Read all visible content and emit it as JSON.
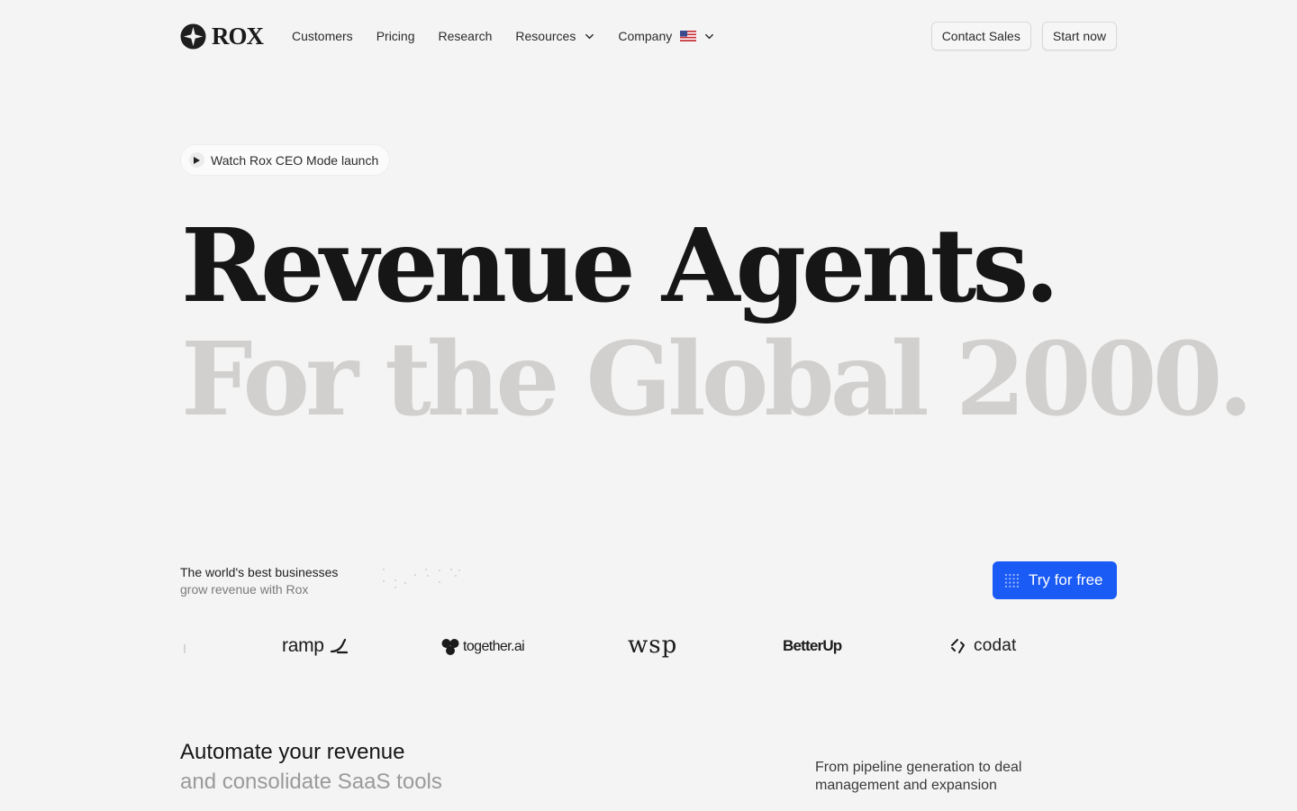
{
  "brand": {
    "name": "ROX",
    "icon": "compass-star-icon"
  },
  "nav": {
    "links": [
      {
        "label": "Customers"
      },
      {
        "label": "Pricing"
      },
      {
        "label": "Research"
      },
      {
        "label": "Resources"
      },
      {
        "label": "Company"
      }
    ],
    "contact_label": "Contact Sales",
    "start_label": "Start now"
  },
  "announcement": {
    "label": "Watch Rox CEO Mode launch"
  },
  "hero": {
    "line1": "Revenue Agents.",
    "line2": "For the Global 2000."
  },
  "proof": {
    "line1": "The world's best businesses",
    "line2": "grow revenue with Rox"
  },
  "cta": {
    "label": "Try for free"
  },
  "logos": [
    "ramp",
    "together.ai",
    "wsp",
    "BetterUp",
    "codat"
  ],
  "bottom": {
    "left_line1": "Automate your revenue",
    "left_line2": "and consolidate SaaS tools",
    "right_text": "From pipeline generation to deal management and expansion"
  },
  "colors": {
    "background": "#f4f4f4",
    "cta": "#1a5af5",
    "hero_primary": "#161616",
    "hero_secondary": "#d2d0ce"
  }
}
